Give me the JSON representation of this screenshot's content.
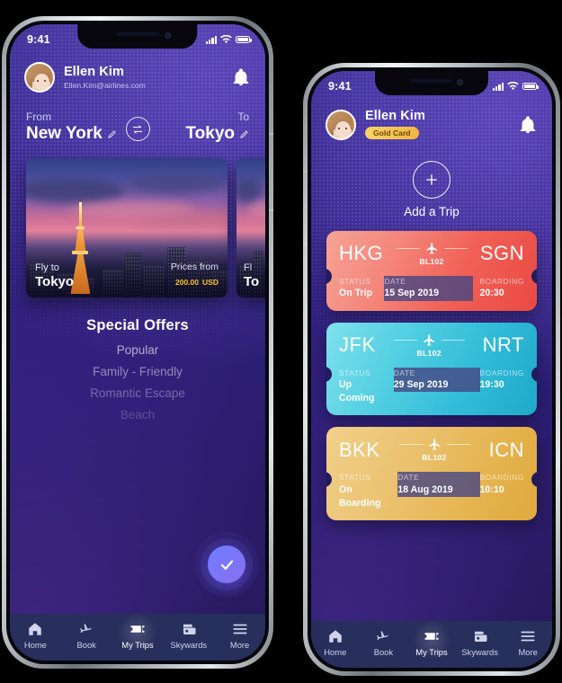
{
  "background_color": "#000000",
  "phones": {
    "left": {
      "status_bar": {
        "time": "9:41",
        "signal": "signal-bars",
        "wifi": "wifi-icon",
        "battery": "battery-icon"
      },
      "user": {
        "name": "Ellen Kim",
        "email": "Ellen.Kim@airlines.com"
      },
      "notification_icon": "bell-icon",
      "search": {
        "from_label": "From",
        "from_value": "New York",
        "to_label": "To",
        "to_value": "Tokyo",
        "swap_icon": "swap-icon",
        "edit_icon": "pencil-icon"
      },
      "destinations": [
        {
          "fly_to_label": "Fly to",
          "city": "Tokyo",
          "price_label": "Prices from",
          "price": "200.00",
          "currency": "USD"
        },
        {
          "fly_to_label": "Fl",
          "city": "To"
        }
      ],
      "offers": {
        "title": "Special Offers",
        "items": [
          "Popular",
          "Family - Friendly",
          "Romantic Escape",
          "Beach"
        ]
      },
      "fab": {
        "icon": "check-icon",
        "color": "#7a7bf5"
      }
    },
    "right": {
      "status_bar": {
        "time": "9:41",
        "signal": "signal-bars",
        "wifi": "wifi-icon",
        "battery": "battery-icon"
      },
      "user": {
        "name": "Ellen Kim",
        "badge": "Gold Card",
        "badge_color": "#f0b43f"
      },
      "notification_icon": "bell-icon",
      "add_trip": {
        "label": "Add a Trip",
        "icon": "plus-icon"
      },
      "tickets": [
        {
          "origin": "HKG",
          "destination": "SGN",
          "flight_no": "BL102",
          "color": "#f15f55",
          "status_label": "STATUS",
          "status_value": "On Trip",
          "date_label": "DATE",
          "date_value": "15 Sep 2019",
          "boarding_label": "BOARDING",
          "boarding_value": "20:30"
        },
        {
          "origin": "JFK",
          "destination": "NRT",
          "flight_no": "BL102",
          "color": "#2fbad6",
          "status_label": "STATUS",
          "status_value": "Up Coming",
          "date_label": "DATE",
          "date_value": "29 Sep 2019",
          "boarding_label": "BOARDING",
          "boarding_value": "19:30"
        },
        {
          "origin": "BKK",
          "destination": "ICN",
          "flight_no": "BL102",
          "color": "#e5b44f",
          "status_label": "STATUS",
          "status_value": "On Boarding",
          "date_label": "DATE",
          "date_value": "18 Aug 2019",
          "boarding_label": "BOARDING",
          "boarding_value": "10:10"
        }
      ]
    }
  },
  "tabbar": {
    "items": [
      {
        "label": "Home",
        "icon": "home-icon",
        "active": false
      },
      {
        "label": "Book",
        "icon": "plane-icon",
        "active": false
      },
      {
        "label": "My Trips",
        "icon": "ticket-icon",
        "active": true
      },
      {
        "label": "Skywards",
        "icon": "cards-icon",
        "active": false
      },
      {
        "label": "More",
        "icon": "menu-icon",
        "active": false
      }
    ]
  }
}
